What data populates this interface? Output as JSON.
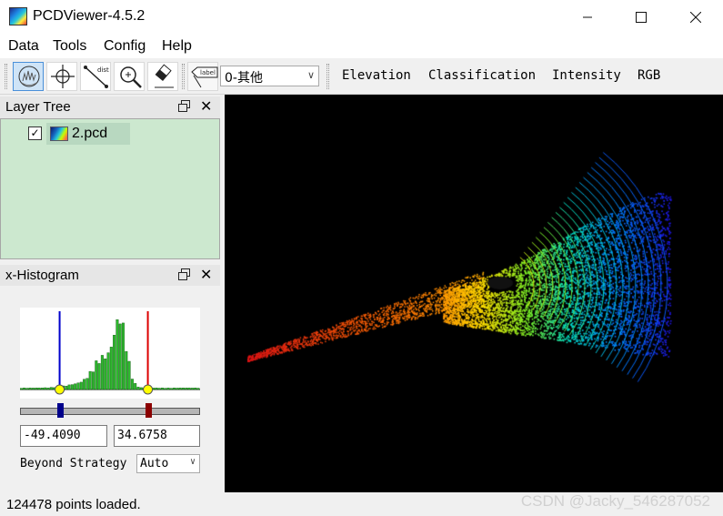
{
  "window": {
    "title": "PCDViewer-4.5.2",
    "minimize_glyph": "—",
    "maximize_glyph": "☐",
    "close_glyph": "✕"
  },
  "menu": [
    "Data",
    "Tools",
    "Config",
    "Help"
  ],
  "toolbar": {
    "tools": [
      "pick-tool-icon",
      "crosshair-icon",
      "distance-icon",
      "zoom-icon",
      "eraser-icon",
      "label-icon"
    ],
    "distance_text": "dist",
    "label_text": "label",
    "class_select": "0-其他",
    "color_modes": [
      "Elevation",
      "Classification",
      "Intensity",
      "RGB"
    ]
  },
  "layer_tree": {
    "title": "Layer Tree",
    "items": [
      {
        "label": "2.pcd",
        "checked": true
      }
    ],
    "background": "#cce8cf"
  },
  "histogram": {
    "title": "x-Histogram",
    "min_value": "-49.4090",
    "max_value": "34.6758",
    "beyond_label": "Beyond Strategy",
    "beyond_value": "Auto",
    "min_handle_fraction": 0.22,
    "max_handle_fraction": 0.71,
    "min_color": "#0000cc",
    "max_color": "#dd0000",
    "bar_color": "#2db82d"
  },
  "status": {
    "message": "124478 points loaded.",
    "watermark": "CSDN @Jacky_546287052"
  }
}
